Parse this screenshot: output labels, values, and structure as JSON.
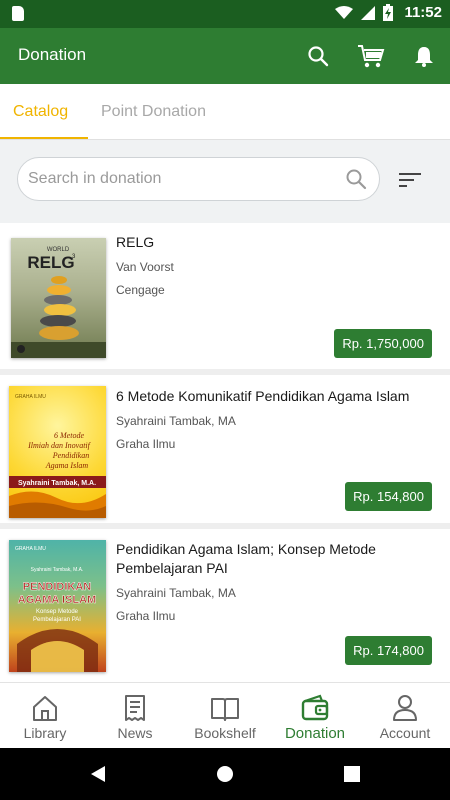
{
  "status_bar": {
    "time": "11:52"
  },
  "app_bar": {
    "title": "Donation",
    "icons": [
      "search-icon",
      "cart-icon",
      "bell-icon"
    ]
  },
  "tabs": [
    {
      "label": "Catalog",
      "active": true
    },
    {
      "label": "Point Donation",
      "active": false
    }
  ],
  "search": {
    "placeholder": "Search in donation",
    "value": ""
  },
  "books": [
    {
      "title": "RELG",
      "author": "Van Voorst",
      "publisher": "Cengage",
      "price": "Rp. 1,750,000",
      "cover": {
        "top_text": "WORLD",
        "big_text": "RELG",
        "sup": "3"
      }
    },
    {
      "title": "6 Metode Komunikatif Pendidikan Agama Islam",
      "author": "Syahraini Tambak, MA",
      "publisher": "Graha Ilmu",
      "price": "Rp. 154,800",
      "cover": {
        "publisher": "GRAHA ILMU",
        "lines": [
          "6 Metode",
          "Ilmiah dan Inovatif",
          "Pendidikan",
          "Agama Islam"
        ],
        "author": "Syahraini Tambak, M.A."
      }
    },
    {
      "title": "Pendidikan Agama Islam; Konsep Metode Pembelajaran PAI",
      "author": "Syahraini Tambak, MA",
      "publisher": "Graha Ilmu",
      "price": "Rp. 174,800",
      "cover": {
        "publisher": "GRAHA ILMU",
        "author": "Syahraini Tambak, M.A.",
        "lines": [
          "PENDIDIKAN",
          "AGAMA ISLAM"
        ],
        "sub": [
          "Konsep Metode",
          "Pembelajaran PAI"
        ]
      }
    }
  ],
  "bottom_nav": [
    {
      "label": "Library",
      "icon": "home-icon",
      "active": false
    },
    {
      "label": "News",
      "icon": "news-icon",
      "active": false
    },
    {
      "label": "Bookshelf",
      "icon": "book-icon",
      "active": false
    },
    {
      "label": "Donation",
      "icon": "wallet-icon",
      "active": true
    },
    {
      "label": "Account",
      "icon": "person-icon",
      "active": false
    }
  ],
  "colors": {
    "primary": "#2e7d32",
    "primary_dark": "#1b5e20",
    "accent": "#f0b400"
  }
}
